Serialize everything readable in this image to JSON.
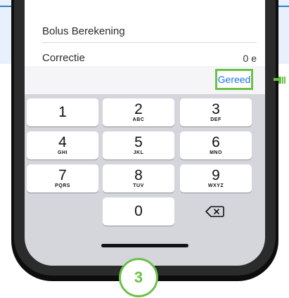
{
  "list": {
    "row1_label": "Bolus Berekening",
    "row2_label": "Correctie",
    "row2_value": "0 e"
  },
  "accessory": {
    "done_label": "Gereed"
  },
  "keypad": {
    "k1": {
      "num": "1",
      "sub": ""
    },
    "k2": {
      "num": "2",
      "sub": "ABC"
    },
    "k3": {
      "num": "3",
      "sub": "DEF"
    },
    "k4": {
      "num": "4",
      "sub": "GHI"
    },
    "k5": {
      "num": "5",
      "sub": "JKL"
    },
    "k6": {
      "num": "6",
      "sub": "MNO"
    },
    "k7": {
      "num": "7",
      "sub": "PQRS"
    },
    "k8": {
      "num": "8",
      "sub": "TUV"
    },
    "k9": {
      "num": "9",
      "sub": "WXYZ"
    },
    "k0": {
      "num": "0"
    }
  },
  "step_badge": "3",
  "colors": {
    "accent_green": "#6cc04a",
    "link_blue": "#1b73e8",
    "top_line": "#2a7fc9"
  }
}
